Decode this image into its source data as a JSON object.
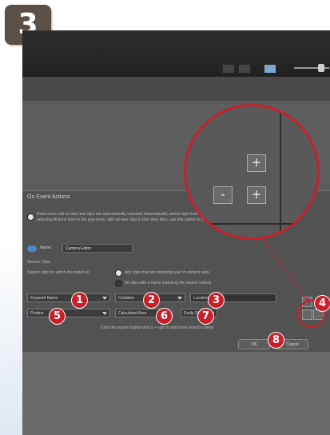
{
  "step_badge": "3",
  "dialog": {
    "title": "On Event Actions",
    "option_description": "Draw a live edit so that new clips are automatically selected. Automatically added clips from the DS can be switched to auto-remove by selecting Actions from in the pop-down, with all new clips in this view. Also, use this option to create additional camera edits.",
    "name_label": "Name:",
    "name_value": "Camera Editor",
    "section_label": "Search Clips:",
    "match_label": "Search clips for which the match is:",
    "radio_any": "Any clips that are matching user in content view",
    "radio_all": "All clips with a name matching the search criteria",
    "criteria_hint": "Click the square button with a + sign to add more search criteria",
    "row1": {
      "field": "Keyword Name",
      "operator": "Contains",
      "value": "Location"
    },
    "row2": {
      "field": "Pristine",
      "operator": "Calculated Area",
      "value": "Emily ON"
    },
    "ok_label": "OK",
    "cancel_label": "Cancel"
  },
  "magnifier": {
    "plus_top": "+",
    "minus": "-",
    "plus_bottom": "+"
  },
  "callouts": [
    "1",
    "2",
    "3",
    "4",
    "5",
    "6",
    "7",
    "8"
  ],
  "colors": {
    "callout": "#c8202b",
    "badge": "#5b5048",
    "accent_blue": "#4f86c6"
  }
}
